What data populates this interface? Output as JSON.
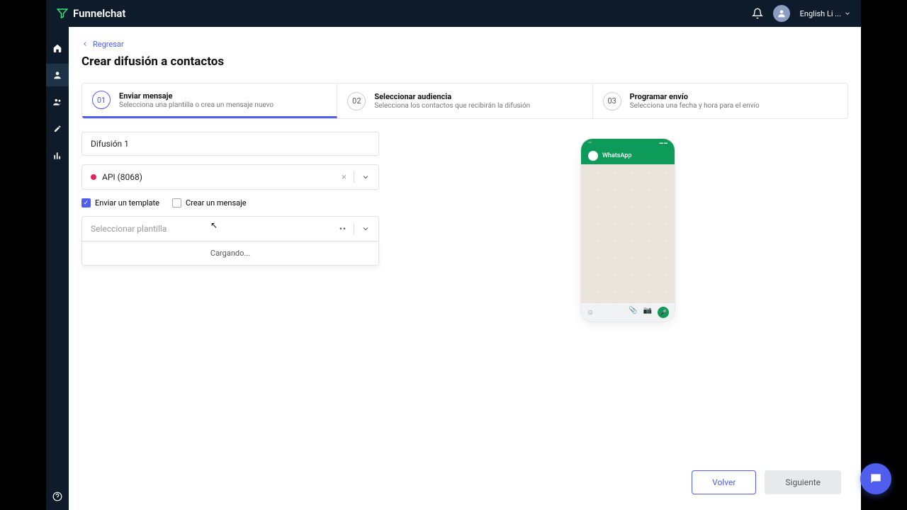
{
  "brand": "Funnelchat",
  "header": {
    "language": "English Li ..."
  },
  "back_label": "Regresar",
  "page_title": "Crear difusión a contactos",
  "steps": [
    {
      "num": "01",
      "title": "Enviar mensaje",
      "sub": "Selecciona una plantilla o crea un mensaje nuevo"
    },
    {
      "num": "02",
      "title": "Seleccionar audiencia",
      "sub": "Selecciona los contactos que recibirán la difusión"
    },
    {
      "num": "03",
      "title": "Programar envío",
      "sub": "Selecciona una fecha y hora para el envío"
    }
  ],
  "form": {
    "diffusion_name": "Difusión 1",
    "api_label": "API (8068)",
    "template_check": "Enviar un template",
    "message_check": "Crear un mensaje",
    "template_placeholder": "Seleccionar plantilla",
    "loading": "Cargando..."
  },
  "preview": {
    "app_name": "WhatsApp"
  },
  "buttons": {
    "back": "Volver",
    "next": "Siguiente"
  }
}
